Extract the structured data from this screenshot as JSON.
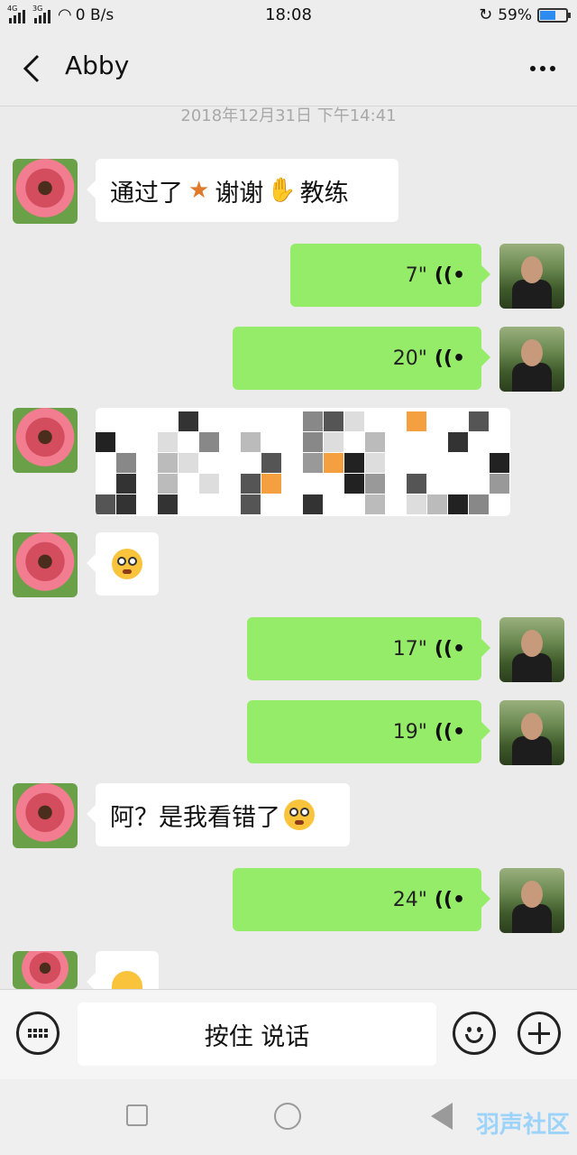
{
  "status_bar": {
    "net_label_1": "4G",
    "net_label_2": "3G",
    "speed": "0 B/s",
    "time": "18:08",
    "battery": "59%",
    "battery_level": 0.59
  },
  "header": {
    "title": "Abby"
  },
  "chat": {
    "timestamp": "2018年12月31日 下午14:41",
    "messages": [
      {
        "from": "her",
        "type": "text",
        "parts": [
          "通过了",
          "谢谢",
          "教练"
        ]
      },
      {
        "from": "me",
        "type": "voice",
        "duration": "7\""
      },
      {
        "from": "me",
        "type": "voice",
        "duration": "20\""
      },
      {
        "from": "her",
        "type": "image",
        "note": ""
      },
      {
        "from": "her",
        "type": "emoji"
      },
      {
        "from": "me",
        "type": "voice",
        "duration": "17\""
      },
      {
        "from": "me",
        "type": "voice",
        "duration": "19\""
      },
      {
        "from": "her",
        "type": "text",
        "text": "阿？是我看错了"
      },
      {
        "from": "me",
        "type": "voice",
        "duration": "24\""
      },
      {
        "from": "her",
        "type": "emoji"
      }
    ]
  },
  "input_bar": {
    "hold_to_talk": "按住 说话"
  },
  "watermark": "羽声社区",
  "colors": {
    "bubble_out": "#95ec69",
    "bubble_in": "#ffffff",
    "background": "#ebebeb"
  }
}
